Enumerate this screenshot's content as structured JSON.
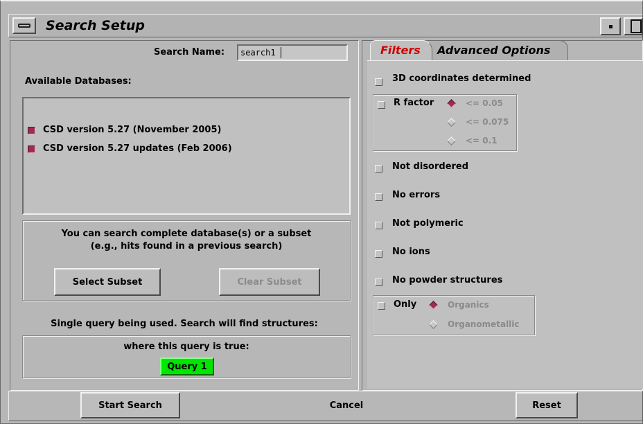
{
  "window": {
    "title": "Search Setup",
    "minimize_glyph": "▪",
    "menu_glyph": "▬"
  },
  "search_name": {
    "label": "Search Name:",
    "value": "search1"
  },
  "databases": {
    "heading": "Available Databases:",
    "items": [
      {
        "label": "CSD version 5.27 (November 2005)",
        "checked": true
      },
      {
        "label": "CSD version 5.27 updates (Feb 2006)",
        "checked": true
      }
    ]
  },
  "subset": {
    "line1": "You can search complete database(s) or a subset",
    "line2": "(e.g., hits found in a previous search)",
    "select_label": "Select Subset",
    "clear_label": "Clear Subset"
  },
  "query": {
    "summary": "Single query being used. Search will find structures:",
    "condition": "where this query is true:",
    "chip_label": "Query 1",
    "chip_color": "#00e600"
  },
  "tabs": {
    "filters": "Filters",
    "advanced": "Advanced Options",
    "active_color": "#d00000"
  },
  "filters": {
    "coords": "3D coordinates determined",
    "rfactor": {
      "label": "R factor",
      "options": [
        "<= 0.05",
        "<= 0.075",
        "<= 0.1"
      ]
    },
    "not_disordered": "Not disordered",
    "no_errors": "No errors",
    "not_polymeric": "Not polymeric",
    "no_ions": "No ions",
    "no_powder": "No powder structures",
    "only": {
      "label": "Only",
      "options": [
        "Organics",
        "Organometallic"
      ]
    }
  },
  "buttons": {
    "start": "Start Search",
    "cancel": "Cancel",
    "reset": "Reset"
  }
}
